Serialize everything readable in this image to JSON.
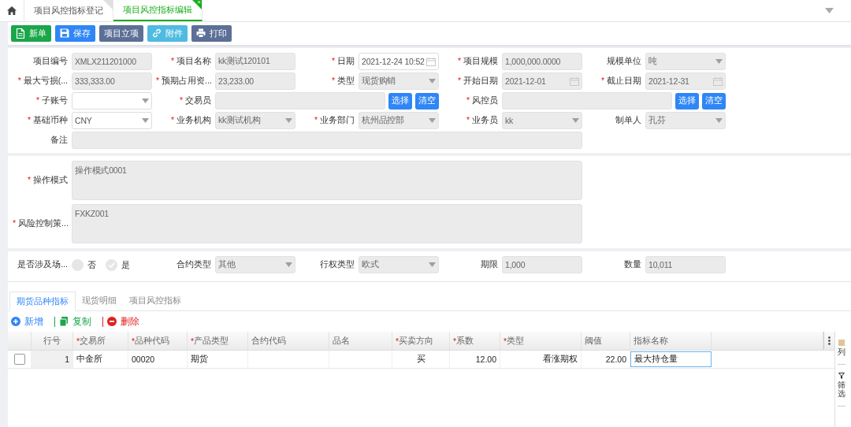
{
  "top_tabs": [
    {
      "label": "项目风控指标登记",
      "selected": false
    },
    {
      "label": "项目风控指标编辑",
      "selected": true,
      "close": "×"
    }
  ],
  "toolbar": [
    {
      "label": "新单",
      "kind": "new"
    },
    {
      "label": "保存",
      "kind": "save"
    },
    {
      "label": "项目立项",
      "kind": "plain"
    },
    {
      "label": "附件",
      "kind": "attach"
    },
    {
      "label": "打印",
      "kind": "print"
    }
  ],
  "form_sections": [
    {
      "fields": [
        {
          "label": "项目编号",
          "kind": "text",
          "value": "XMLX211201000",
          "disabled": true
        },
        {
          "asterisk": "*",
          "label": "项目名称",
          "kind": "text",
          "value": "kk测试120101",
          "disabled": true
        },
        {
          "asterisk": "*",
          "label": "日期",
          "kind": "date",
          "value": "2021-12-24 10:52",
          "disabled": false
        },
        {
          "asterisk": "*",
          "label": "项目规模",
          "kind": "text",
          "value": "1,000,000.0000",
          "disabled": true
        },
        {
          "label": "规模单位",
          "kind": "select",
          "value": "吨",
          "disabled": true
        },
        {
          "asterisk": "*",
          "label": "最大亏损(...",
          "kind": "text",
          "value": "333,333.00",
          "disabled": true
        },
        {
          "asterisk": "*",
          "label": "预期占用资...",
          "kind": "text",
          "value": "23,233.00",
          "disabled": true
        },
        {
          "asterisk": "*",
          "label": "类型",
          "kind": "select",
          "value": "现货购销",
          "disabled": true
        },
        {
          "asterisk": "*",
          "label": "开始日期",
          "kind": "date",
          "value": "2021-12-01",
          "disabled": true
        },
        {
          "asterisk": "*",
          "label": "截止日期",
          "kind": "date",
          "value": "2021-12-31",
          "disabled": true
        },
        {
          "asterisk": "*",
          "label": "子账号",
          "kind": "select",
          "disabled": false
        },
        {
          "asterisk": "*",
          "label": "交易员",
          "kind": "picker",
          "disabled": true,
          "buttons": [
            "选择",
            "清空"
          ]
        },
        {
          "asterisk": "*",
          "label": "风控员",
          "kind": "picker",
          "disabled": true,
          "buttons": [
            "选择",
            "清空"
          ]
        },
        {
          "asterisk": "*",
          "label": "基础币种",
          "kind": "select",
          "value": "CNY",
          "disabled": false
        },
        {
          "asterisk": "*",
          "label": "业务机构",
          "kind": "select",
          "value": "kk测试机构",
          "disabled": true
        },
        {
          "asterisk": "*",
          "label": "业务部门",
          "kind": "select",
          "value": "杭州品控部",
          "disabled": true
        },
        {
          "asterisk": "*",
          "label": "业务员",
          "kind": "select",
          "value": "kk",
          "disabled": true
        },
        {
          "label": "制单人",
          "kind": "select",
          "value": "孔芬",
          "disabled": true
        },
        {
          "label": "备注",
          "kind": "note",
          "disabled": true
        }
      ]
    },
    {
      "fields": [
        {
          "asterisk": "*",
          "label": "操作模式",
          "kind": "textarea",
          "value": "操作模式0001",
          "disabled": true
        },
        {
          "asterisk": "*",
          "label": "风险控制策...",
          "kind": "textarea",
          "value": "FXKZ001",
          "disabled": true
        }
      ]
    },
    {
      "fields": [
        {
          "label": "是否涉及场...",
          "kind": "radio",
          "options": [
            {
              "label": "否",
              "selected": false
            },
            {
              "label": "是",
              "selected": true
            }
          ]
        },
        {
          "label": "合约类型",
          "kind": "select",
          "value": "其他",
          "disabled": true
        },
        {
          "label": "行权类型",
          "kind": "select",
          "value": "欧式",
          "disabled": true
        },
        {
          "label": "期限",
          "kind": "text",
          "value": "1,000",
          "disabled": true
        },
        {
          "label": "数量",
          "kind": "text",
          "value": "10,011",
          "disabled": true
        }
      ]
    }
  ],
  "detail_tabs": [
    {
      "label": "期货品种指标",
      "selected": true
    },
    {
      "label": "现货明细",
      "selected": false
    },
    {
      "label": "项目风控指标",
      "selected": false
    }
  ],
  "grid_actions": [
    {
      "label": "新增",
      "kind": "add"
    },
    {
      "label": "复制",
      "kind": "copy"
    },
    {
      "label": "删除",
      "kind": "delete"
    }
  ],
  "table": {
    "columns": [
      {
        "label": "行号"
      },
      {
        "asterisk": "*",
        "label": "交易所"
      },
      {
        "asterisk": "*",
        "label": "品种代码"
      },
      {
        "asterisk": "*",
        "label": "产品类型"
      },
      {
        "label": "合约代码"
      },
      {
        "label": "品名"
      },
      {
        "asterisk": "*",
        "label": "买卖方向"
      },
      {
        "asterisk": "*",
        "label": "系数"
      },
      {
        "asterisk": "*",
        "label": "类型"
      },
      {
        "label": "阈值"
      },
      {
        "label": "指标名称"
      }
    ],
    "rows": [
      {
        "checked": false,
        "cells": [
          "1",
          "中金所",
          "00020",
          "期货",
          "",
          "",
          "买",
          "12.00",
          "看涨期权",
          "22.00",
          "最大持仓量"
        ]
      }
    ]
  },
  "side_panel": [
    {
      "label": "列",
      "kind": "columns"
    },
    {
      "label": "筛选",
      "kind": "filter"
    }
  ]
}
